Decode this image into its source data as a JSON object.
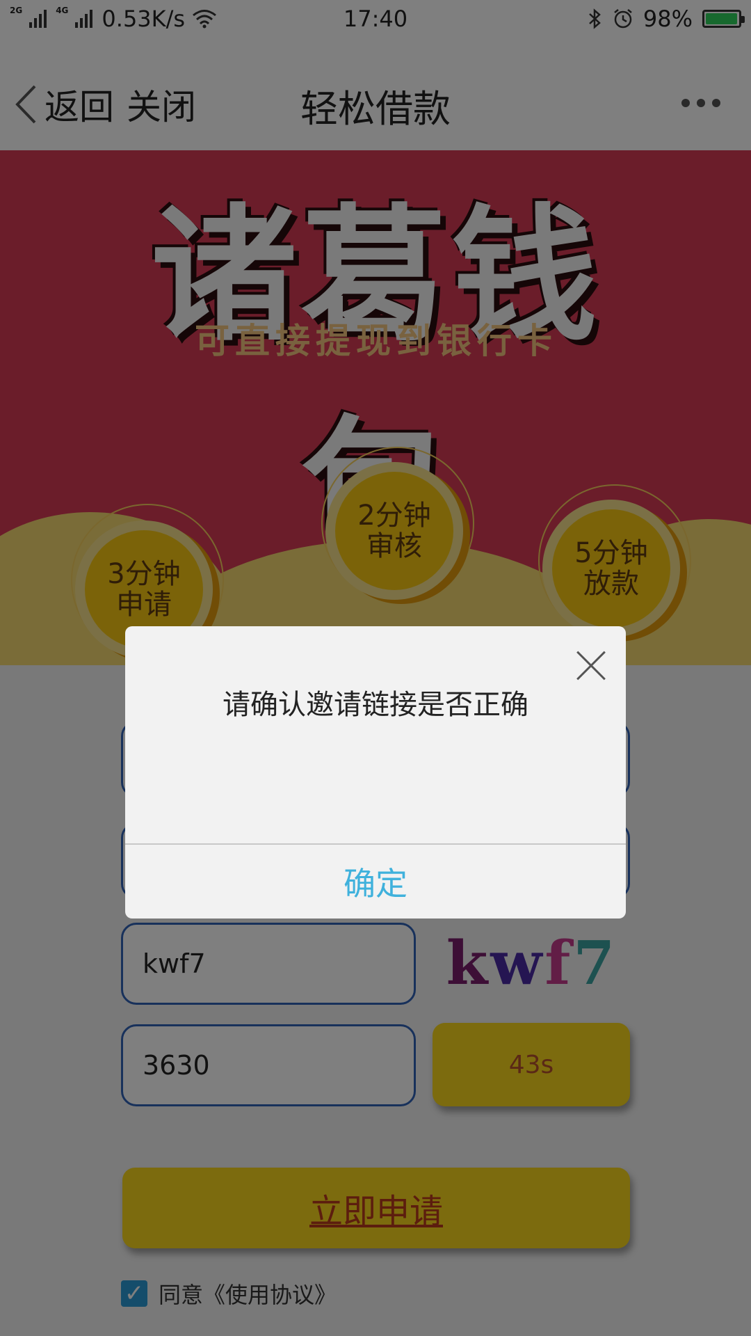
{
  "status_bar": {
    "net1": "2G",
    "net2": "4G",
    "speed": "0.53K/s",
    "time": "17:40",
    "battery": "98%",
    "battery_level": 0.98
  },
  "nav": {
    "back": "返回",
    "close": "关闭",
    "title": "轻松借款"
  },
  "banner": {
    "brand": "诸葛钱包",
    "slogan": "可直接提现到银行卡",
    "steps": [
      {
        "line1": "3分钟",
        "line2": "申请"
      },
      {
        "line1": "2分钟",
        "line2": "审核"
      },
      {
        "line1": "5分钟",
        "line2": "放款"
      }
    ]
  },
  "form": {
    "captcha_value": "kwf7",
    "captcha_image_text": "kwf7",
    "sms_code_value": "3630",
    "countdown": "43s",
    "apply_label": "立即申请",
    "agree_label": "同意《使用协议》"
  },
  "dialog": {
    "message": "请确认邀请链接是否正确",
    "confirm": "确定"
  }
}
